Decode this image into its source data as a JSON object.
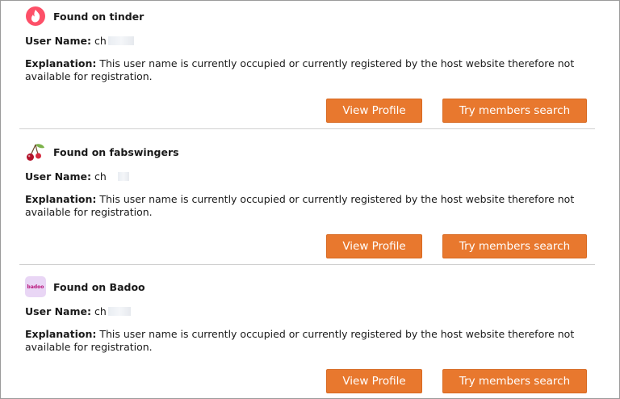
{
  "results": [
    {
      "icon": "tinder-flame-icon",
      "title": "Found on tinder",
      "username_label": "User Name:",
      "username_value": "ch",
      "explanation_label": "Explanation:",
      "explanation_text": "This user name is currently occupied or currently registered by the host website therefore not available for registration.",
      "view_profile_label": "View Profile",
      "members_search_label": "Try members search"
    },
    {
      "icon": "fabswingers-cherry-icon",
      "title": "Found on fabswingers",
      "username_label": "User Name:",
      "username_value": "ch",
      "explanation_label": "Explanation:",
      "explanation_text": "This user name is currently occupied or currently registered by the host website therefore not available for registration.",
      "view_profile_label": "View Profile",
      "members_search_label": "Try members search"
    },
    {
      "icon": "badoo-logo-icon",
      "icon_text": "badoo",
      "title": "Found on Badoo",
      "username_label": "User Name:",
      "username_value": "ch",
      "explanation_label": "Explanation:",
      "explanation_text": "This user name is currently occupied or currently registered by the host website therefore not available for registration.",
      "view_profile_label": "View Profile",
      "members_search_label": "Try members search"
    }
  ],
  "colors": {
    "button_bg": "#e8782e",
    "button_text": "#ffffff",
    "tinder": "#fd5068",
    "badoo_bg": "#e9d6f5",
    "badoo_text": "#b8127a"
  }
}
